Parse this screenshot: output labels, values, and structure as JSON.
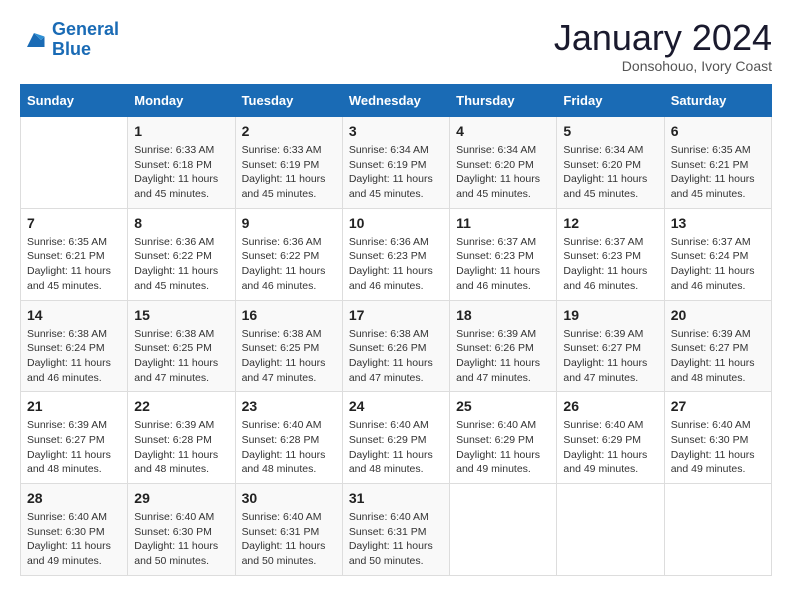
{
  "header": {
    "logo_line1": "General",
    "logo_line2": "Blue",
    "month_title": "January 2024",
    "subtitle": "Donsohouo, Ivory Coast"
  },
  "weekdays": [
    "Sunday",
    "Monday",
    "Tuesday",
    "Wednesday",
    "Thursday",
    "Friday",
    "Saturday"
  ],
  "weeks": [
    [
      {
        "day": "",
        "info": ""
      },
      {
        "day": "1",
        "info": "Sunrise: 6:33 AM\nSunset: 6:18 PM\nDaylight: 11 hours and 45 minutes."
      },
      {
        "day": "2",
        "info": "Sunrise: 6:33 AM\nSunset: 6:19 PM\nDaylight: 11 hours and 45 minutes."
      },
      {
        "day": "3",
        "info": "Sunrise: 6:34 AM\nSunset: 6:19 PM\nDaylight: 11 hours and 45 minutes."
      },
      {
        "day": "4",
        "info": "Sunrise: 6:34 AM\nSunset: 6:20 PM\nDaylight: 11 hours and 45 minutes."
      },
      {
        "day": "5",
        "info": "Sunrise: 6:34 AM\nSunset: 6:20 PM\nDaylight: 11 hours and 45 minutes."
      },
      {
        "day": "6",
        "info": "Sunrise: 6:35 AM\nSunset: 6:21 PM\nDaylight: 11 hours and 45 minutes."
      }
    ],
    [
      {
        "day": "7",
        "info": "Sunrise: 6:35 AM\nSunset: 6:21 PM\nDaylight: 11 hours and 45 minutes."
      },
      {
        "day": "8",
        "info": "Sunrise: 6:36 AM\nSunset: 6:22 PM\nDaylight: 11 hours and 45 minutes."
      },
      {
        "day": "9",
        "info": "Sunrise: 6:36 AM\nSunset: 6:22 PM\nDaylight: 11 hours and 46 minutes."
      },
      {
        "day": "10",
        "info": "Sunrise: 6:36 AM\nSunset: 6:23 PM\nDaylight: 11 hours and 46 minutes."
      },
      {
        "day": "11",
        "info": "Sunrise: 6:37 AM\nSunset: 6:23 PM\nDaylight: 11 hours and 46 minutes."
      },
      {
        "day": "12",
        "info": "Sunrise: 6:37 AM\nSunset: 6:23 PM\nDaylight: 11 hours and 46 minutes."
      },
      {
        "day": "13",
        "info": "Sunrise: 6:37 AM\nSunset: 6:24 PM\nDaylight: 11 hours and 46 minutes."
      }
    ],
    [
      {
        "day": "14",
        "info": "Sunrise: 6:38 AM\nSunset: 6:24 PM\nDaylight: 11 hours and 46 minutes."
      },
      {
        "day": "15",
        "info": "Sunrise: 6:38 AM\nSunset: 6:25 PM\nDaylight: 11 hours and 47 minutes."
      },
      {
        "day": "16",
        "info": "Sunrise: 6:38 AM\nSunset: 6:25 PM\nDaylight: 11 hours and 47 minutes."
      },
      {
        "day": "17",
        "info": "Sunrise: 6:38 AM\nSunset: 6:26 PM\nDaylight: 11 hours and 47 minutes."
      },
      {
        "day": "18",
        "info": "Sunrise: 6:39 AM\nSunset: 6:26 PM\nDaylight: 11 hours and 47 minutes."
      },
      {
        "day": "19",
        "info": "Sunrise: 6:39 AM\nSunset: 6:27 PM\nDaylight: 11 hours and 47 minutes."
      },
      {
        "day": "20",
        "info": "Sunrise: 6:39 AM\nSunset: 6:27 PM\nDaylight: 11 hours and 48 minutes."
      }
    ],
    [
      {
        "day": "21",
        "info": "Sunrise: 6:39 AM\nSunset: 6:27 PM\nDaylight: 11 hours and 48 minutes."
      },
      {
        "day": "22",
        "info": "Sunrise: 6:39 AM\nSunset: 6:28 PM\nDaylight: 11 hours and 48 minutes."
      },
      {
        "day": "23",
        "info": "Sunrise: 6:40 AM\nSunset: 6:28 PM\nDaylight: 11 hours and 48 minutes."
      },
      {
        "day": "24",
        "info": "Sunrise: 6:40 AM\nSunset: 6:29 PM\nDaylight: 11 hours and 48 minutes."
      },
      {
        "day": "25",
        "info": "Sunrise: 6:40 AM\nSunset: 6:29 PM\nDaylight: 11 hours and 49 minutes."
      },
      {
        "day": "26",
        "info": "Sunrise: 6:40 AM\nSunset: 6:29 PM\nDaylight: 11 hours and 49 minutes."
      },
      {
        "day": "27",
        "info": "Sunrise: 6:40 AM\nSunset: 6:30 PM\nDaylight: 11 hours and 49 minutes."
      }
    ],
    [
      {
        "day": "28",
        "info": "Sunrise: 6:40 AM\nSunset: 6:30 PM\nDaylight: 11 hours and 49 minutes."
      },
      {
        "day": "29",
        "info": "Sunrise: 6:40 AM\nSunset: 6:30 PM\nDaylight: 11 hours and 50 minutes."
      },
      {
        "day": "30",
        "info": "Sunrise: 6:40 AM\nSunset: 6:31 PM\nDaylight: 11 hours and 50 minutes."
      },
      {
        "day": "31",
        "info": "Sunrise: 6:40 AM\nSunset: 6:31 PM\nDaylight: 11 hours and 50 minutes."
      },
      {
        "day": "",
        "info": ""
      },
      {
        "day": "",
        "info": ""
      },
      {
        "day": "",
        "info": ""
      }
    ]
  ]
}
